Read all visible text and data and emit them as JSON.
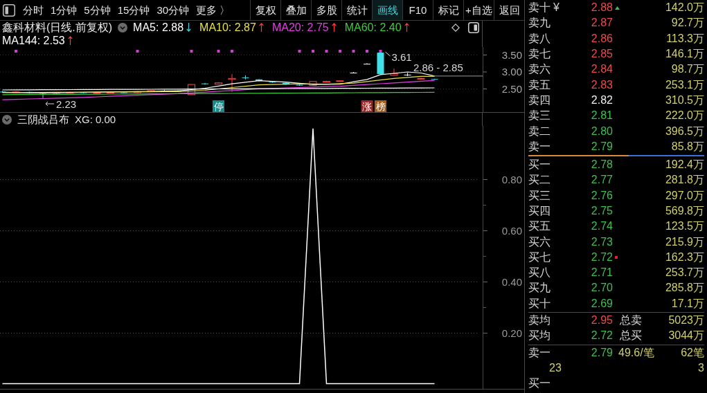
{
  "toolbar": {
    "periods": [
      {
        "label": "分时",
        "selected": false
      },
      {
        "label": "1分钟",
        "selected": false
      },
      {
        "label": "5分钟",
        "selected": false
      },
      {
        "label": "15分钟",
        "selected": false
      },
      {
        "label": "30分钟",
        "selected": false
      },
      {
        "label": "更多 〉",
        "selected": false
      }
    ],
    "tools": [
      {
        "label": "复权",
        "selected": false
      },
      {
        "label": "叠加",
        "selected": false
      },
      {
        "label": "多股",
        "selected": false
      },
      {
        "label": "统计",
        "selected": false
      },
      {
        "label": "画线",
        "selected": true
      },
      {
        "label": "F10",
        "selected": false
      },
      {
        "label": "标记",
        "selected": false
      },
      {
        "label": "+自选",
        "selected": false
      },
      {
        "label": "返回",
        "selected": false
      }
    ]
  },
  "price_chart": {
    "title": "鑫科材料(日线.前复权)",
    "moving_average_rows": [
      [
        {
          "label": "MA5: 2.88",
          "color": "#ffffff",
          "rising": false
        },
        {
          "label": "MA10: 2.87",
          "color": "#e6e04a",
          "rising": true
        },
        {
          "label": "MA20: 2.75",
          "color": "#e040e0",
          "rising": true
        },
        {
          "label": "MA60: 2.40",
          "color": "#3ccc3c",
          "rising": true
        }
      ],
      [
        {
          "label": "MA144: 2.53",
          "color": "#ffffff",
          "rising": true
        }
      ]
    ],
    "y_axis": [
      "3.50",
      "3.00",
      "2.50"
    ],
    "high_label": "3.61",
    "last_price_label": "2.86 - 2.85",
    "low_label": "2.23",
    "tags": [
      {
        "text": "停",
        "color": "#168c8c"
      },
      {
        "text": "涨",
        "color": "#9a2626"
      },
      {
        "text": "榜",
        "color": "#a45e1e"
      }
    ]
  },
  "indicator": {
    "title": "三阴战吕布",
    "readout": "XG: 0.00",
    "chart_data": {
      "type": "line",
      "ylim": [
        -0.02,
        1.01
      ],
      "yticks": [
        {
          "value": 0.8,
          "label": "0.80"
        },
        {
          "value": 0.6,
          "label": "0.60"
        },
        {
          "value": 0.4,
          "label": "0.40"
        },
        {
          "value": 0.2,
          "label": "0.20"
        }
      ],
      "grid": true,
      "values": [
        0,
        0,
        0,
        0,
        0,
        0,
        0,
        0,
        0,
        0,
        0,
        0,
        0,
        0,
        0,
        0,
        0,
        0,
        0,
        0,
        0,
        0,
        0,
        1,
        0,
        0,
        0,
        0,
        0,
        0,
        0,
        0,
        0
      ]
    }
  },
  "order_book": {
    "asks": [
      {
        "label": "卖十",
        "currency": "¥",
        "price": "2.88",
        "color": "#f04a4a",
        "flagged": true,
        "volume": "142.0万"
      },
      {
        "label": "卖九",
        "price": "2.87",
        "color": "#f04a4a",
        "flagged": false,
        "volume": "92.7万"
      },
      {
        "label": "卖八",
        "price": "2.86",
        "color": "#f04a4a",
        "flagged": false,
        "volume": "113.3万"
      },
      {
        "label": "卖七",
        "price": "2.85",
        "color": "#f04a4a",
        "flagged": false,
        "volume": "146.1万"
      },
      {
        "label": "卖六",
        "price": "2.84",
        "color": "#f04a4a",
        "flagged": false,
        "volume": "98.7万"
      },
      {
        "label": "卖五",
        "price": "2.83",
        "color": "#f04a4a",
        "flagged": false,
        "volume": "253.1万"
      },
      {
        "label": "卖四",
        "price": "2.82",
        "color": "#f0f0f0",
        "flagged": false,
        "volume": "310.5万"
      },
      {
        "label": "卖三",
        "price": "2.81",
        "color": "#3fc04f",
        "flagged": false,
        "volume": "222.0万"
      },
      {
        "label": "卖二",
        "price": "2.80",
        "color": "#3fc04f",
        "flagged": false,
        "volume": "396.5万"
      },
      {
        "label": "卖一",
        "price": "2.79",
        "color": "#3fc04f",
        "flagged": false,
        "volume": "85.8万"
      }
    ],
    "ratio_bar": {
      "level": 0.57
    },
    "bids": [
      {
        "label": "买一",
        "price": "2.78",
        "color": "#3fc04f",
        "flagged": false,
        "volume": "192.4万"
      },
      {
        "label": "买二",
        "price": "2.77",
        "color": "#3fc04f",
        "flagged": false,
        "volume": "281.8万"
      },
      {
        "label": "买三",
        "price": "2.76",
        "color": "#3fc04f",
        "flagged": false,
        "volume": "297.0万"
      },
      {
        "label": "买四",
        "price": "2.75",
        "color": "#3fc04f",
        "flagged": false,
        "volume": "569.8万"
      },
      {
        "label": "买五",
        "price": "2.74",
        "color": "#3fc04f",
        "flagged": false,
        "volume": "123.5万"
      },
      {
        "label": "买六",
        "price": "2.73",
        "color": "#3fc04f",
        "flagged": false,
        "volume": "215.9万"
      },
      {
        "label": "买七",
        "price": "2.72",
        "color": "#3fc04f",
        "flagged": true,
        "volume": "162.3万"
      },
      {
        "label": "买八",
        "price": "2.71",
        "color": "#3fc04f",
        "flagged": false,
        "volume": "253.7万"
      },
      {
        "label": "买九",
        "price": "2.70",
        "color": "#3fc04f",
        "flagged": false,
        "volume": "285.8万"
      },
      {
        "label": "买十",
        "price": "2.69",
        "color": "#3fc04f",
        "flagged": false,
        "volume": "17.1万"
      }
    ],
    "summary": [
      {
        "label": "卖均",
        "price": "2.95",
        "color": "#f04a4a",
        "total_label": "总卖",
        "total": "5023万"
      },
      {
        "label": "买均",
        "price": "2.72",
        "color": "#3fc04f",
        "total_label": "总买",
        "total": "3044万"
      }
    ],
    "trades": [
      {
        "label": "卖一",
        "price": "2.79",
        "color": "#3fc04f",
        "detail": "49.6/笔",
        "count": "62笔"
      },
      {
        "amount": "23",
        "count": "3"
      },
      {
        "label": "买一"
      }
    ]
  }
}
